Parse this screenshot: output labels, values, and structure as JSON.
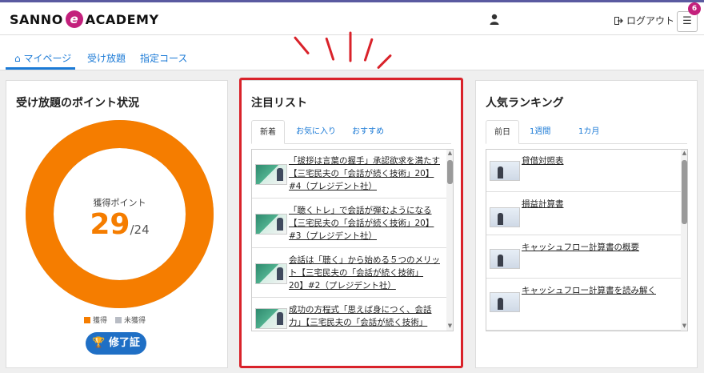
{
  "header": {
    "logo_left": "SANNO",
    "logo_e": "e",
    "logo_right": "ACADEMY",
    "logout_label": "ログアウト",
    "menu_badge": "6"
  },
  "nav": {
    "tabs": [
      {
        "label": "マイページ",
        "active": true
      },
      {
        "label": "受け放題",
        "active": false
      },
      {
        "label": "指定コース",
        "active": false
      }
    ]
  },
  "points_card": {
    "title": "受け放題のポイント状況",
    "center_label": "獲得ポイント",
    "earned": "29",
    "total": "/24",
    "earned_fraction": 1.0,
    "legend": [
      {
        "label": "獲得",
        "color": "#f57d00"
      },
      {
        "label": "未獲得",
        "color": "#b8bcc4"
      }
    ],
    "certificate_button": "修了証",
    "accent_color": "#f57d00"
  },
  "attention_card": {
    "title": "注目リスト",
    "tabs": [
      "新着",
      "お気に入り",
      "おすすめ"
    ],
    "active_tab": 0,
    "items": [
      {
        "lines": [
          "「拔拶は言葉の握手」承認欲求を満たす",
          "【三宅民夫の「会話が続く技術」20】",
          "#4（プレジデント社）"
        ]
      },
      {
        "lines": [
          "「聴くトレ」で会話が弾むようになる",
          "【三宅民夫の「会話が続く技術」20】",
          "#3（プレジデント社）"
        ]
      },
      {
        "lines": [
          "会話は「聴く」から始める５つのメリッ",
          "ト【三宅民夫の「会話が続く技術」",
          "20】#2（プレジデント社）"
        ]
      },
      {
        "lines": [
          "成功の方程式「思えば身につく、会話",
          "力」【三宅民夫の「会話が続く技術」"
        ]
      }
    ]
  },
  "ranking_card": {
    "title": "人気ランキング",
    "tabs": [
      "前日",
      "1週間",
      "1カ月"
    ],
    "active_tab": 0,
    "items": [
      {
        "label": "貸借対照表"
      },
      {
        "label": "損益計算書"
      },
      {
        "label": "キャッシュフロー計算書の概要"
      },
      {
        "label": "キャッシュフロー計算書を読み解く"
      }
    ]
  },
  "highlight_color": "#d9222a"
}
